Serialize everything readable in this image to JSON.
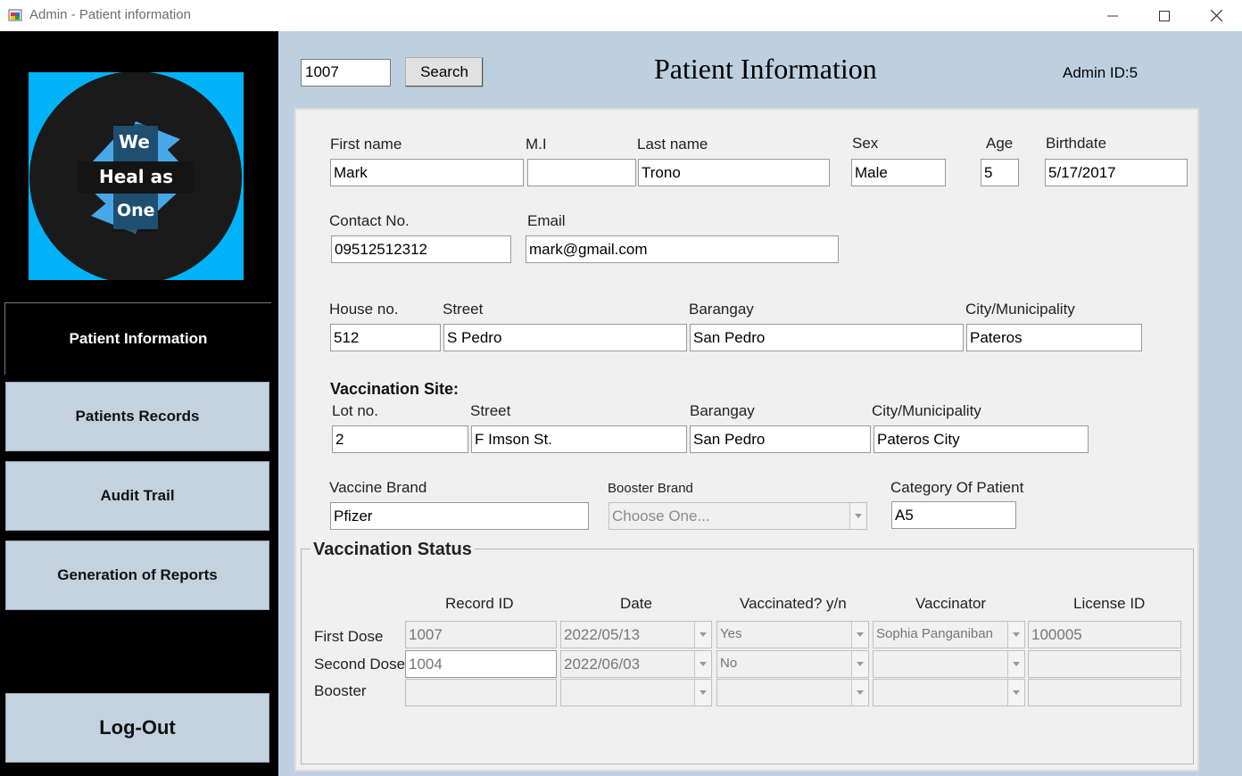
{
  "window": {
    "title": "Admin - Patient information"
  },
  "logo": {
    "line1": "We",
    "line2": "Heal as",
    "line3": "One"
  },
  "sidebar": {
    "items": [
      {
        "label": "Patient Information"
      },
      {
        "label": "Patients Records"
      },
      {
        "label": "Audit Trail"
      },
      {
        "label": "Generation of Reports"
      }
    ],
    "logout": "Log-Out"
  },
  "header": {
    "search_value": "1007",
    "search_button": "Search",
    "title": "Patient Information",
    "admin_id": "Admin ID:5"
  },
  "patient": {
    "labels": {
      "first_name": "First name",
      "mi": "M.I",
      "last_name": "Last name",
      "sex": "Sex",
      "age": "Age",
      "birthdate": "Birthdate",
      "contact": "Contact No.",
      "email": "Email",
      "house": "House no.",
      "street": "Street",
      "barangay": "Barangay",
      "city": "City/Municipality"
    },
    "first_name": "Mark",
    "mi": "",
    "last_name": "Trono",
    "sex": "Male",
    "age": "5",
    "birthdate": "5/17/2017",
    "contact": "09512512312",
    "email": "mark@gmail.com",
    "house": "512",
    "street": "S Pedro",
    "barangay": "San Pedro",
    "city": "Pateros"
  },
  "site": {
    "heading": "Vaccination Site:",
    "labels": {
      "lot": "Lot no.",
      "street": "Street",
      "barangay": "Barangay",
      "city": "City/Municipality"
    },
    "lot": "2",
    "street": "F Imson St.",
    "barangay": "San Pedro",
    "city": "Pateros City"
  },
  "vaccine": {
    "labels": {
      "brand": "Vaccine Brand",
      "booster": "Booster Brand",
      "category": "Category Of Patient"
    },
    "brand": "Pfizer",
    "booster_placeholder": "Choose One...",
    "category": "A5"
  },
  "status": {
    "title": "Vaccination Status",
    "columns": [
      "Record ID",
      "Date",
      "Vaccinated? y/n",
      "Vaccinator",
      "License ID"
    ],
    "rows": [
      {
        "label": "First Dose",
        "record": "1007",
        "date": "2022/05/13",
        "vaccinated": "Yes",
        "vaccinator": "Sophia Panganiban",
        "license": "100005"
      },
      {
        "label": "Second Dose",
        "record": "1004",
        "date": "2022/06/03",
        "vaccinated": "No",
        "vaccinator": "",
        "license": ""
      },
      {
        "label": "Booster",
        "record": "",
        "date": "",
        "vaccinated": "",
        "vaccinator": "",
        "license": ""
      }
    ]
  }
}
